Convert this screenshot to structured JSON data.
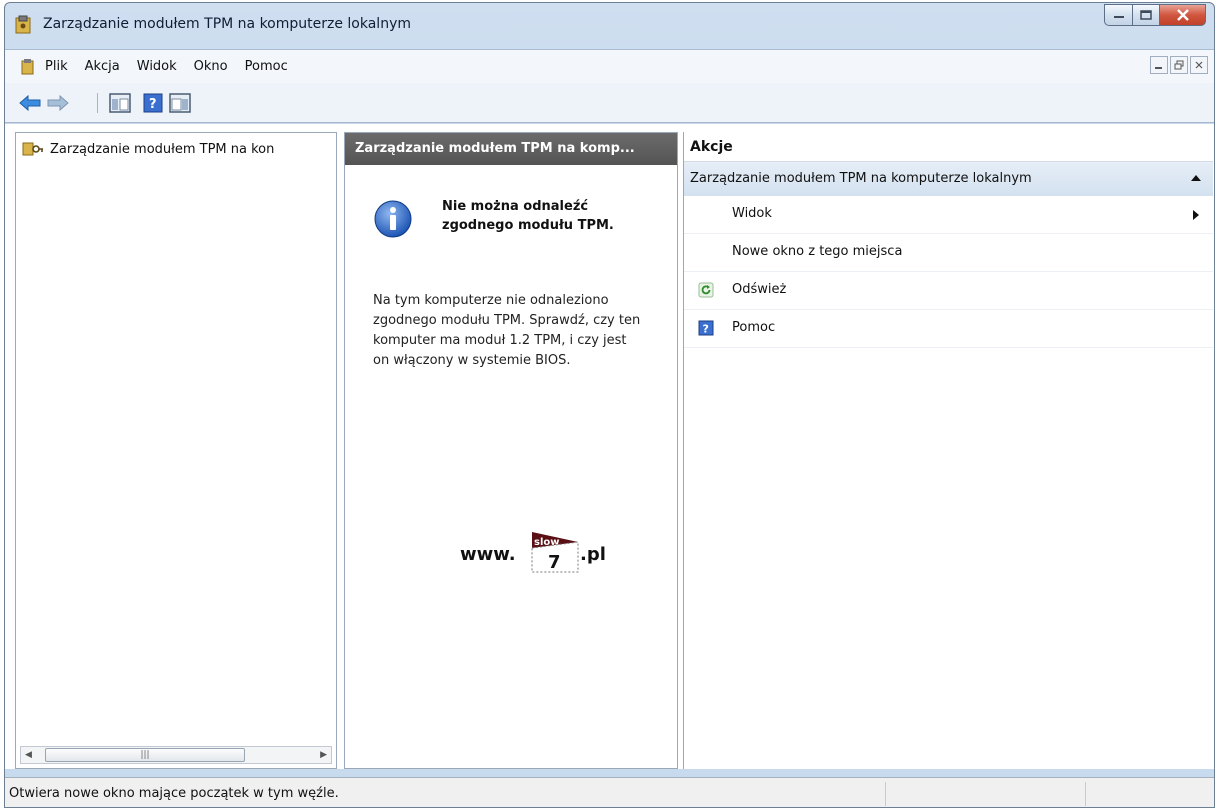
{
  "window": {
    "title": "Zarządzanie modułem TPM na komputerze lokalnym",
    "controls": {
      "minimize": "minimize",
      "maximize": "maximize",
      "close": "close"
    }
  },
  "menu": {
    "items": [
      {
        "label": "Plik"
      },
      {
        "label": "Akcja"
      },
      {
        "label": "Widok"
      },
      {
        "label": "Okno"
      },
      {
        "label": "Pomoc"
      }
    ]
  },
  "toolbar": {
    "icons": [
      "back-arrow-icon",
      "forward-arrow-icon",
      "show-hide-console-tree-icon",
      "help-icon",
      "show-hide-action-pane-icon"
    ]
  },
  "tree": {
    "root_label": "Zarządzanie modułem TPM na kon"
  },
  "center": {
    "header": "Zarządzanie modułem TPM na komp...",
    "message_title": "Nie można odnaleźć zgodnego modułu TPM.",
    "message_body": "Na tym komputerze nie odnaleziono zgodnego modułu TPM. Sprawdź, czy ten komputer ma moduł 1.2 TPM, i czy jest on włączony w systemie BIOS."
  },
  "watermark": {
    "prefix": "www.",
    "flag_text": "slow",
    "number": "7",
    "suffix": ".pl"
  },
  "actions": {
    "header": "Akcje",
    "group": "Zarządzanie modułem TPM na komputerze lokalnym",
    "items": [
      {
        "label": "Widok",
        "has_submenu": true
      },
      {
        "label": "Nowe okno z tego miejsca"
      },
      {
        "label": "Odśwież",
        "icon": "refresh-icon"
      },
      {
        "label": "Pomoc",
        "icon": "help-icon"
      }
    ]
  },
  "status": {
    "text": "Otwiera nowe okno mające początek w tym węźle."
  },
  "colors": {
    "accent": "#3a7bd5",
    "header_dark": "#5a5a5a",
    "close_red": "#c8462e"
  }
}
